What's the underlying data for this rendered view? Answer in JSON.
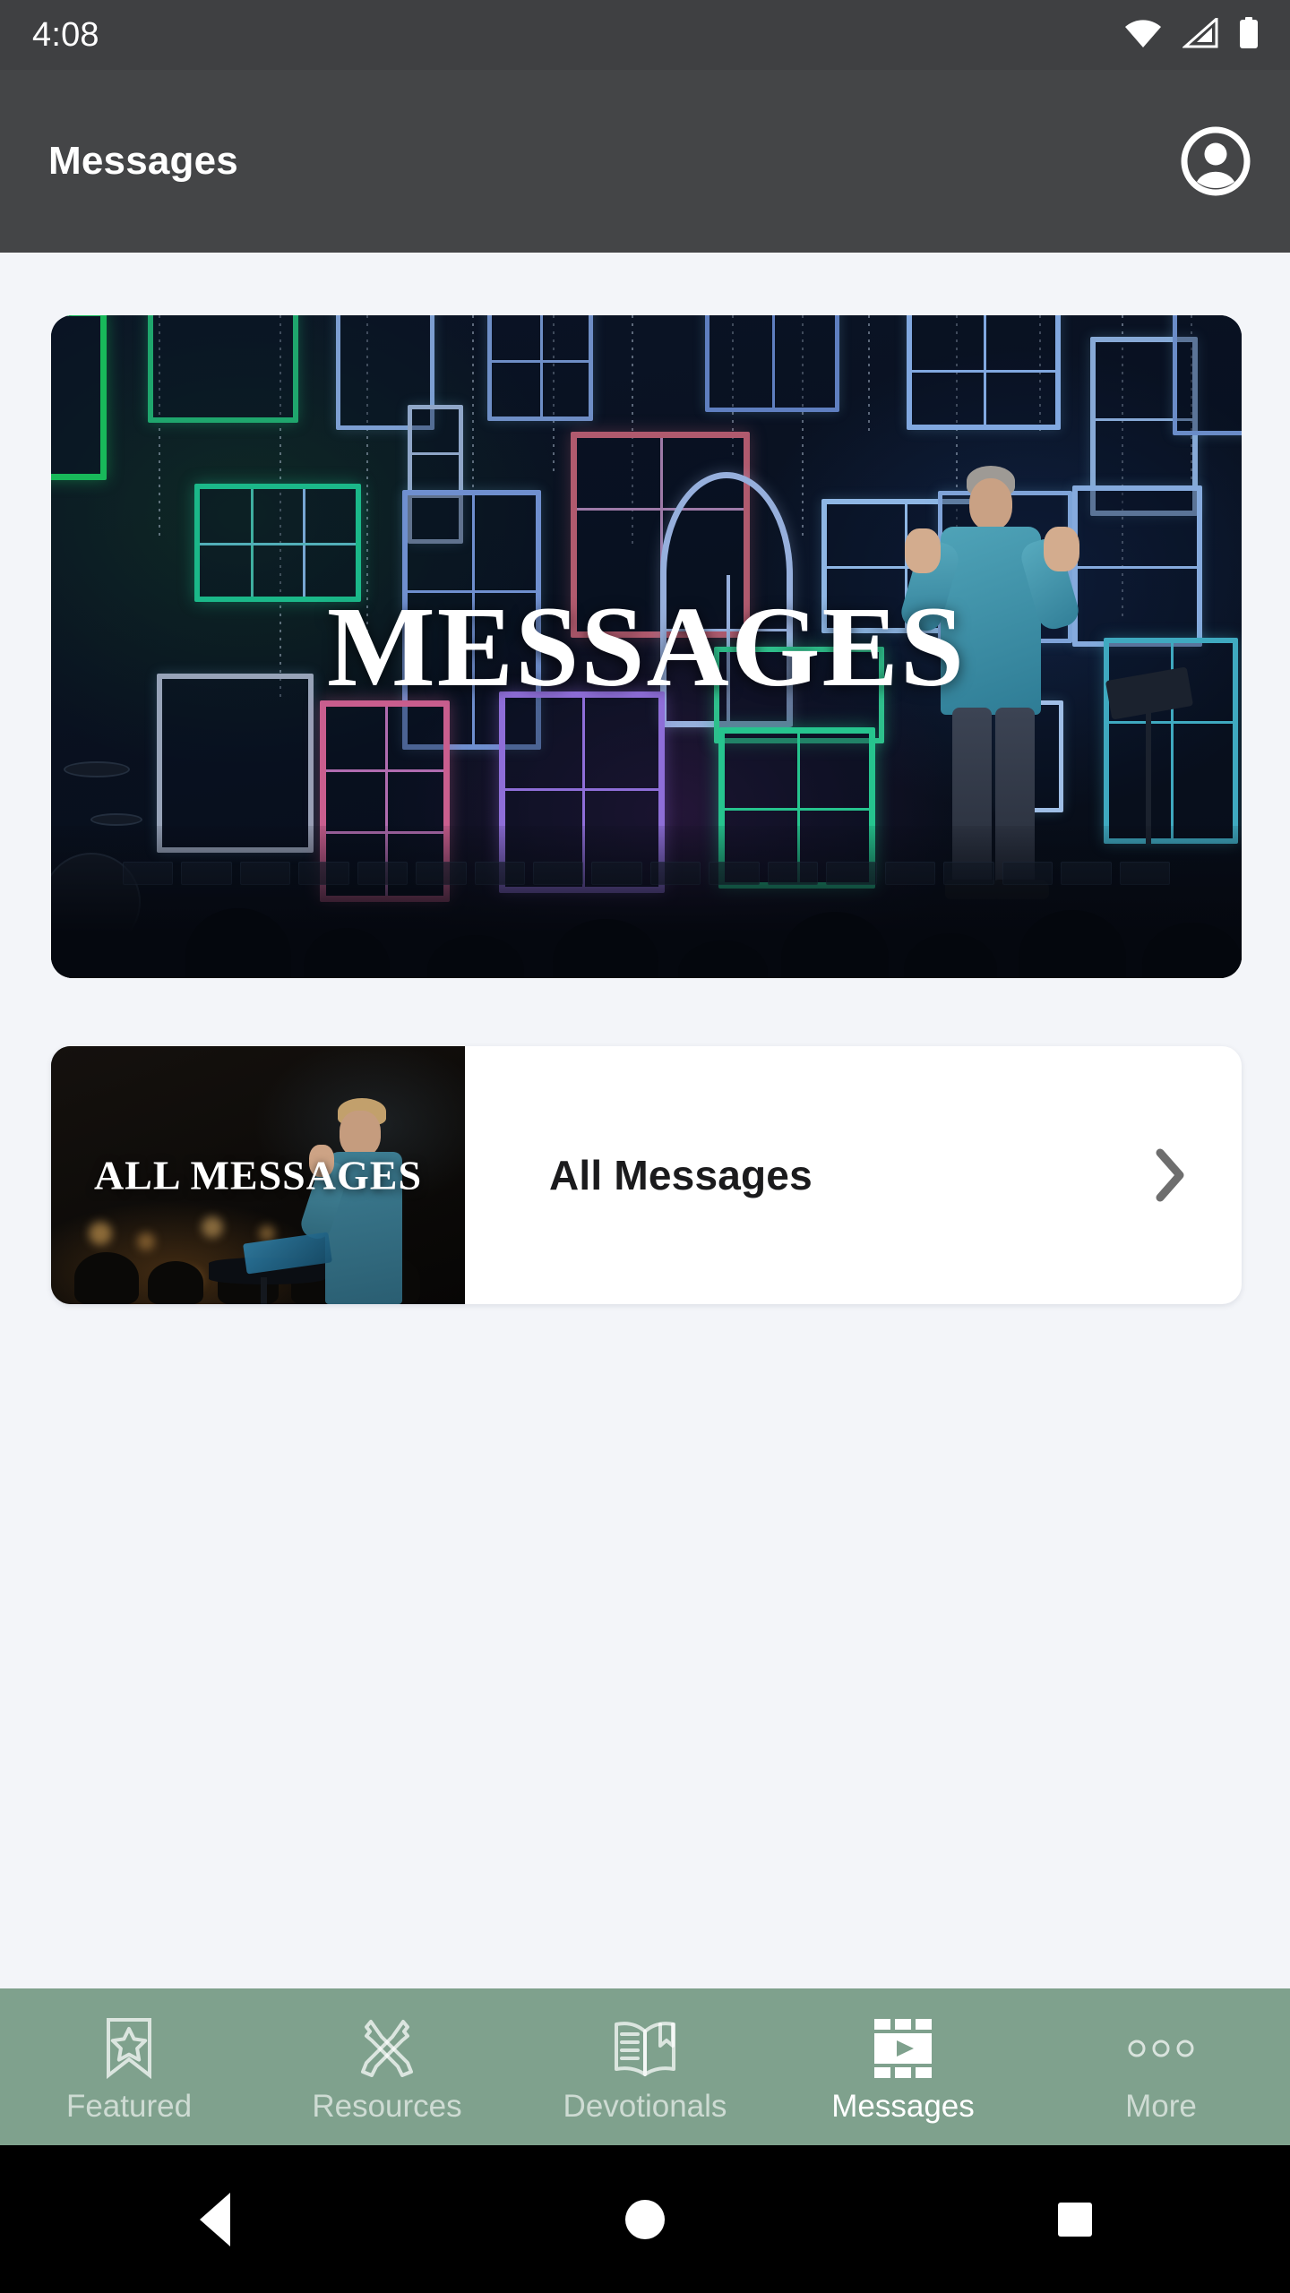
{
  "status_bar": {
    "time": "4:08",
    "icons": [
      "wifi-icon",
      "cellular-signal-icon",
      "battery-icon"
    ]
  },
  "app_bar": {
    "title": "Messages",
    "account_icon": "account-circle-icon"
  },
  "hero": {
    "title": "MESSAGES",
    "image_alt": "Speaker on stage in front of hanging illuminated window frames"
  },
  "all_messages_card": {
    "thumbnail_title": "ALL MESSAGES",
    "label": "All Messages",
    "chevron_icon": "chevron-right-icon"
  },
  "tab_bar": {
    "background_color": "#7FA18D",
    "active_tab": "Messages",
    "items": [
      {
        "label": "Featured",
        "icon": "bookmark-star-icon",
        "active": false
      },
      {
        "label": "Resources",
        "icon": "crossed-wrenches-icon",
        "active": false
      },
      {
        "label": "Devotionals",
        "icon": "open-book-bookmark-icon",
        "active": false
      },
      {
        "label": "Messages",
        "icon": "film-play-icon",
        "active": true
      },
      {
        "label": "More",
        "icon": "three-dots-icon",
        "active": false
      }
    ]
  },
  "android_nav": {
    "back": "back-triangle-icon",
    "home": "home-circle-icon",
    "recents": "recents-square-icon"
  },
  "colors": {
    "status_bar": "#3F4042",
    "app_bar": "#444547",
    "page_background": "#F3F5F9",
    "card_background": "#FFFFFF",
    "tab_bar": "#7FA18D",
    "chevron": "#6E6E6E"
  }
}
